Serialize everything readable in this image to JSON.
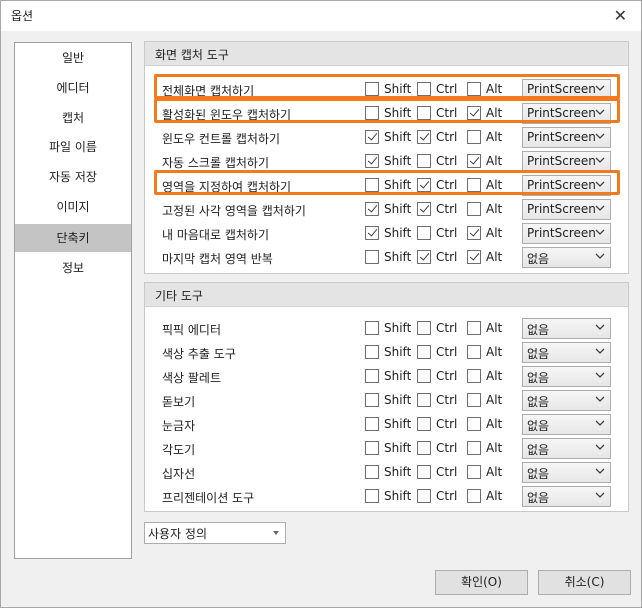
{
  "window": {
    "title": "옵션"
  },
  "sidebar": {
    "items": [
      {
        "label": "일반"
      },
      {
        "label": "에디터"
      },
      {
        "label": "캡처"
      },
      {
        "label": "파일 이름"
      },
      {
        "label": "자동 저장"
      },
      {
        "label": "이미지"
      },
      {
        "label": "단축키",
        "active": true
      },
      {
        "label": "정보"
      }
    ]
  },
  "modifiers": {
    "shift": "Shift",
    "ctrl": "Ctrl",
    "alt": "Alt"
  },
  "capture_tools": {
    "title": "화면 캡처 도구",
    "rows": [
      {
        "label": "전체화면 캡처하기",
        "shift": false,
        "ctrl": false,
        "alt": false,
        "key": "PrintScreen",
        "highlighted": true
      },
      {
        "label": "활성화된 윈도우 캡처하기",
        "shift": false,
        "ctrl": false,
        "alt": true,
        "key": "PrintScreen",
        "highlighted": true
      },
      {
        "label": "윈도우 컨트롤 캡처하기",
        "shift": true,
        "ctrl": true,
        "alt": false,
        "key": "PrintScreen"
      },
      {
        "label": "자동 스크롤 캡처하기",
        "shift": true,
        "ctrl": false,
        "alt": true,
        "key": "PrintScreen"
      },
      {
        "label": "영역을 지정하여 캡처하기",
        "shift": false,
        "ctrl": true,
        "alt": false,
        "key": "PrintScreen",
        "highlighted": true
      },
      {
        "label": "고정된 사각 영역을 캡처하기",
        "shift": true,
        "ctrl": true,
        "alt": false,
        "key": "PrintScreen"
      },
      {
        "label": "내 마음대로 캡처하기",
        "shift": true,
        "ctrl": false,
        "alt": true,
        "key": "PrintScreen"
      },
      {
        "label": "마지막 캡처 영역 반복",
        "shift": false,
        "ctrl": true,
        "alt": true,
        "key": "없음"
      }
    ]
  },
  "other_tools": {
    "title": "기타 도구",
    "rows": [
      {
        "label": "픽픽 에디터",
        "shift": false,
        "ctrl": false,
        "alt": false,
        "key": "없음"
      },
      {
        "label": "색상 추출 도구",
        "shift": false,
        "ctrl": false,
        "alt": false,
        "key": "없음"
      },
      {
        "label": "색상 팔레트",
        "shift": false,
        "ctrl": false,
        "alt": false,
        "key": "없음"
      },
      {
        "label": "돋보기",
        "shift": false,
        "ctrl": false,
        "alt": false,
        "key": "없음"
      },
      {
        "label": "눈금자",
        "shift": false,
        "ctrl": false,
        "alt": false,
        "key": "없음"
      },
      {
        "label": "각도기",
        "shift": false,
        "ctrl": false,
        "alt": false,
        "key": "없음"
      },
      {
        "label": "십자선",
        "shift": false,
        "ctrl": false,
        "alt": false,
        "key": "없음"
      },
      {
        "label": "프리젠테이션 도구",
        "shift": false,
        "ctrl": false,
        "alt": false,
        "key": "없음"
      }
    ]
  },
  "preset": {
    "value": "사용자 정의"
  },
  "buttons": {
    "ok": "확인(O)",
    "cancel": "취소(C)"
  },
  "colors": {
    "highlight": "#f47a20",
    "active_item": "#c4c4c4"
  },
  "icons": {
    "close": "close-icon",
    "chevron": "chevron-down-icon"
  }
}
